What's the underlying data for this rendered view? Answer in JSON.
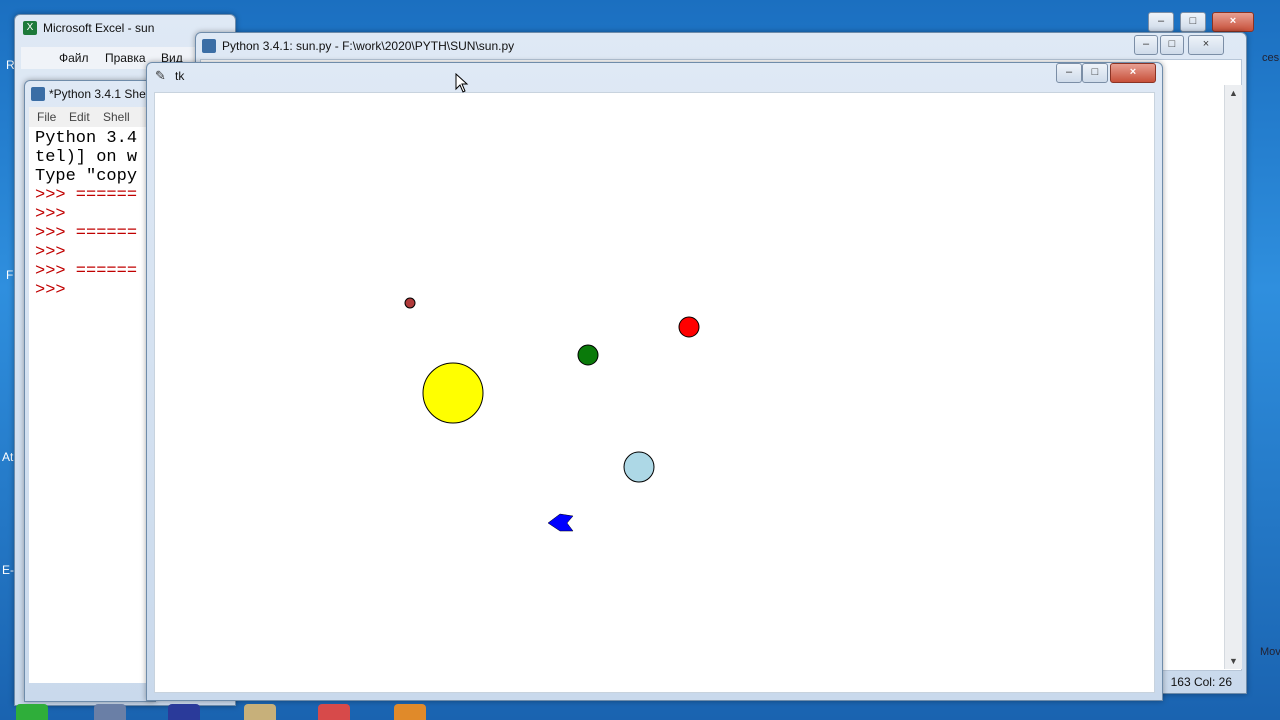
{
  "excel": {
    "title": "Microsoft Excel - sun",
    "menu": [
      "Файл",
      "Правка",
      "Вид"
    ]
  },
  "shell": {
    "title": "*Python 3.4.1 She",
    "menu": [
      "File",
      "Edit",
      "Shell"
    ],
    "lines": [
      {
        "text": "Python 3.4",
        "prompt": false
      },
      {
        "text": "tel)] on w",
        "prompt": false
      },
      {
        "text": "Type \"copy",
        "prompt": false
      },
      {
        "text": ">>> ======",
        "prompt": true
      },
      {
        "text": ">>>",
        "prompt": true
      },
      {
        "text": ">>> ======",
        "prompt": true
      },
      {
        "text": ">>>",
        "prompt": true
      },
      {
        "text": ">>> ======",
        "prompt": true
      },
      {
        "text": ">>>",
        "prompt": true
      }
    ]
  },
  "editor": {
    "title": "Python 3.4.1: sun.py - F:\\work\\2020\\PYTH\\SUN\\sun.py",
    "status": "163 Col: 26"
  },
  "tk": {
    "title": "tk",
    "bodies": [
      {
        "name": "sun",
        "color": "#ffff00",
        "r": 30
      },
      {
        "name": "small-brown-planet",
        "color": "#b03a3a",
        "r": 5
      },
      {
        "name": "green-planet",
        "color": "#0a7a0a",
        "r": 10
      },
      {
        "name": "red-planet",
        "color": "#ff0000",
        "r": 10
      },
      {
        "name": "lightblue-planet",
        "color": "#add8e6",
        "r": 15
      }
    ],
    "comet_color": "#0000ff"
  },
  "desktop": {
    "left_letters": [
      "R",
      "F",
      "At",
      "E-"
    ],
    "right_text": [
      "ces",
      "Mov"
    ]
  },
  "window_controls": {
    "minimize": "–",
    "maximize": "□",
    "close": "×"
  }
}
